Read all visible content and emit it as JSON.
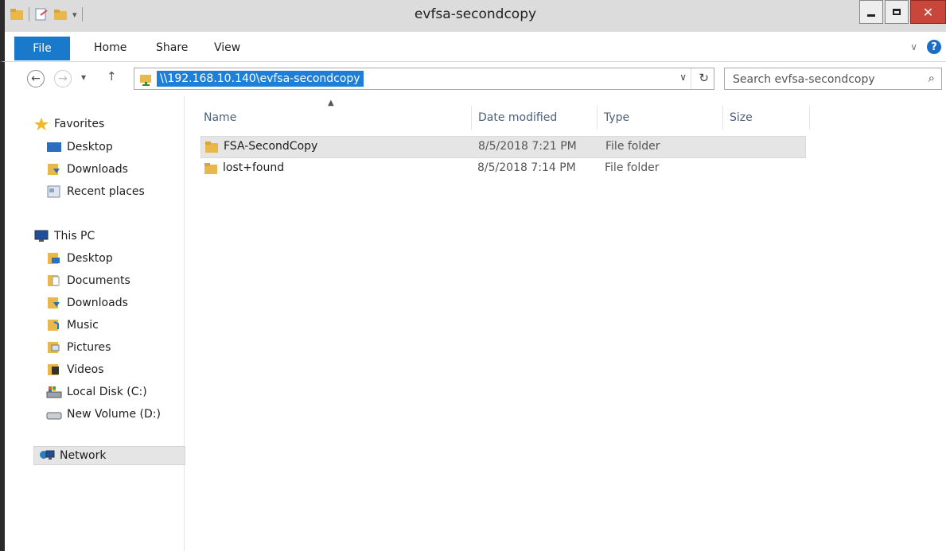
{
  "window": {
    "title": "evfsa-secondcopy"
  },
  "ribbon": {
    "tabs": [
      "File",
      "Home",
      "Share",
      "View"
    ]
  },
  "address": {
    "path": "\\\\192.168.10.140\\evfsa-secondcopy",
    "search_placeholder": "Search evfsa-secondcopy"
  },
  "nav": {
    "favorites": {
      "label": "Favorites",
      "items": [
        "Desktop",
        "Downloads",
        "Recent places"
      ]
    },
    "thispc": {
      "label": "This PC",
      "items": [
        "Desktop",
        "Documents",
        "Downloads",
        "Music",
        "Pictures",
        "Videos",
        "Local Disk (C:)",
        "New Volume (D:)"
      ]
    },
    "network": {
      "label": "Network"
    }
  },
  "files": {
    "columns": [
      "Name",
      "Date modified",
      "Type",
      "Size"
    ],
    "rows": [
      {
        "name": "FSA-SecondCopy",
        "date": "8/5/2018 7:21 PM",
        "type": "File folder",
        "size": ""
      },
      {
        "name": "lost+found",
        "date": "8/5/2018 7:14 PM",
        "type": "File folder",
        "size": ""
      }
    ]
  },
  "colors": {
    "accent": "#1979ca",
    "selection": "#1e7fd8",
    "close": "#c9473a"
  }
}
